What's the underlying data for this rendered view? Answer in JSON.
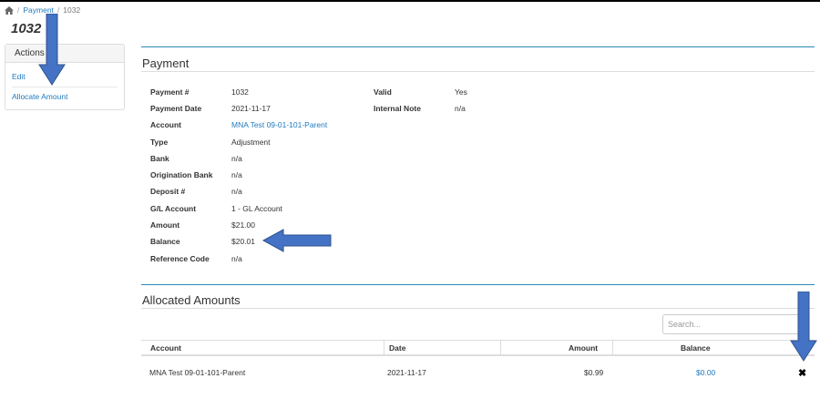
{
  "breadcrumb": {
    "home_icon": "home-icon",
    "sep": "/",
    "parent": "Payment",
    "current": "1032"
  },
  "page_title": "1032",
  "actions": {
    "header": "Actions",
    "items": [
      {
        "label": "Edit"
      },
      {
        "label": "Allocate Amount"
      }
    ]
  },
  "payment": {
    "title": "Payment",
    "left_fields": [
      {
        "label": "Payment #",
        "value": "1032"
      },
      {
        "label": "Payment Date",
        "value": "2021-11-17"
      },
      {
        "label": "Account",
        "value": "MNA Test 09-01-101-Parent"
      },
      {
        "label": "Type",
        "value": "Adjustment"
      },
      {
        "label": "Bank",
        "value": "n/a"
      },
      {
        "label": "Origination Bank",
        "value": "n/a"
      },
      {
        "label": "Deposit #",
        "value": "n/a"
      },
      {
        "label": "G/L Account",
        "value": "1 - GL Account"
      },
      {
        "label": "Amount",
        "value": "$21.00"
      },
      {
        "label": "Balance",
        "value": "$20.01"
      },
      {
        "label": "Reference Code",
        "value": "n/a"
      }
    ],
    "right_fields": [
      {
        "label": "Valid",
        "value": "Yes"
      },
      {
        "label": "Internal Note",
        "value": "n/a"
      }
    ]
  },
  "allocated": {
    "title": "Allocated Amounts",
    "search_placeholder": "Search...",
    "columns": {
      "account": "Account",
      "date": "Date",
      "amount": "Amount",
      "balance": "Balance"
    },
    "rows": [
      {
        "account": "MNA Test 09-01-101-Parent",
        "date": "2021-11-17",
        "amount": "$0.99",
        "balance": "$0.00",
        "delete_icon": "close-icon"
      }
    ]
  },
  "colors": {
    "link": "#1f7bc1",
    "section_rule": "#2a8bb5",
    "annotation_arrow": "#4472c4"
  }
}
